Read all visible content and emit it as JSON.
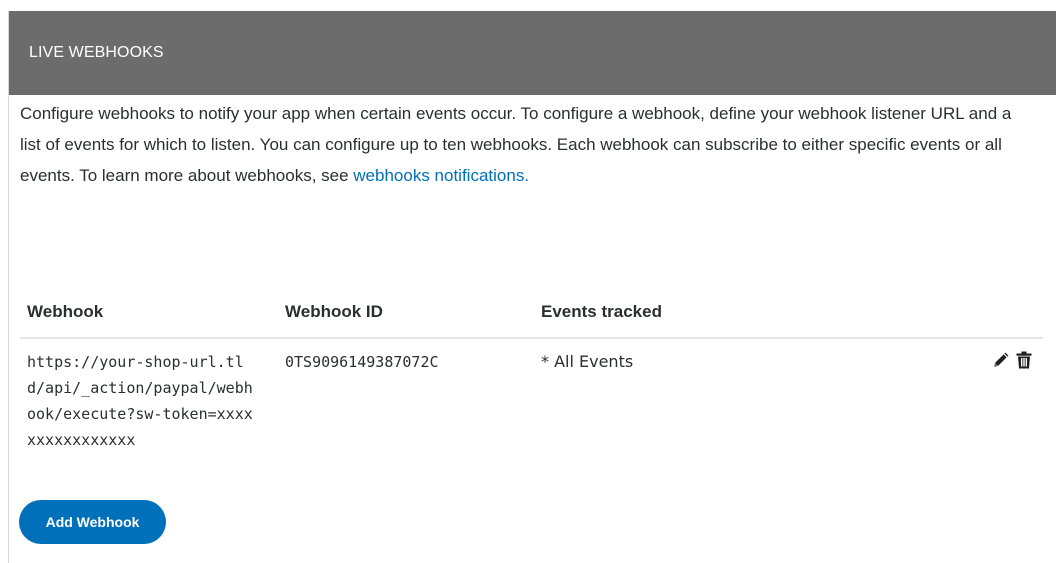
{
  "header": {
    "title": "LIVE WEBHOOKS"
  },
  "intro": {
    "text": "Configure webhooks to notify your app when certain events occur. To configure a webhook, define your webhook listener URL and a list of events for which to listen. You can configure up to ten webhooks. Each webhook can subscribe to either specific events or all events. To learn more about webhooks, see ",
    "link_text": "webhooks notifications."
  },
  "table": {
    "columns": [
      "Webhook",
      "Webhook ID",
      "Events tracked"
    ],
    "rows": [
      {
        "url": "https://your-shop-url.tld/api/_action/paypal/webhook/execute?sw-token=xxxxxxxxxxxxxxxx",
        "id": "0TS9096149387072C",
        "events": "* All Events"
      }
    ]
  },
  "icons": {
    "edit": "pencil-icon",
    "delete": "trash-icon"
  },
  "buttons": {
    "add_label": "Add Webhook"
  },
  "colors": {
    "header_bg": "#6c6c6c",
    "link": "#0070ba",
    "primary_button": "#0070ba"
  }
}
